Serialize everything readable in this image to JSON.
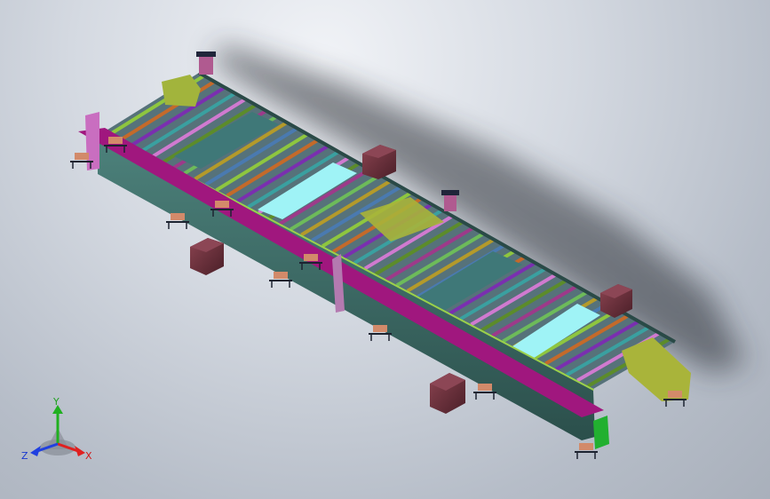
{
  "triad": {
    "x_label": "X",
    "y_label": "Y",
    "z_label": "Z"
  },
  "colors": {
    "background_light": "#f1f3f7",
    "background_dark": "#a9b0bb",
    "frame_teal": "#3f6f6b",
    "frame_magenta": "#a0177e",
    "rail_green": "#8ec63f",
    "panel_cyan": "#9ff3f6",
    "box_maroon": "#6b2f3a",
    "axis_x": "#e02020",
    "axis_y": "#20b020",
    "axis_z": "#2040e0"
  }
}
